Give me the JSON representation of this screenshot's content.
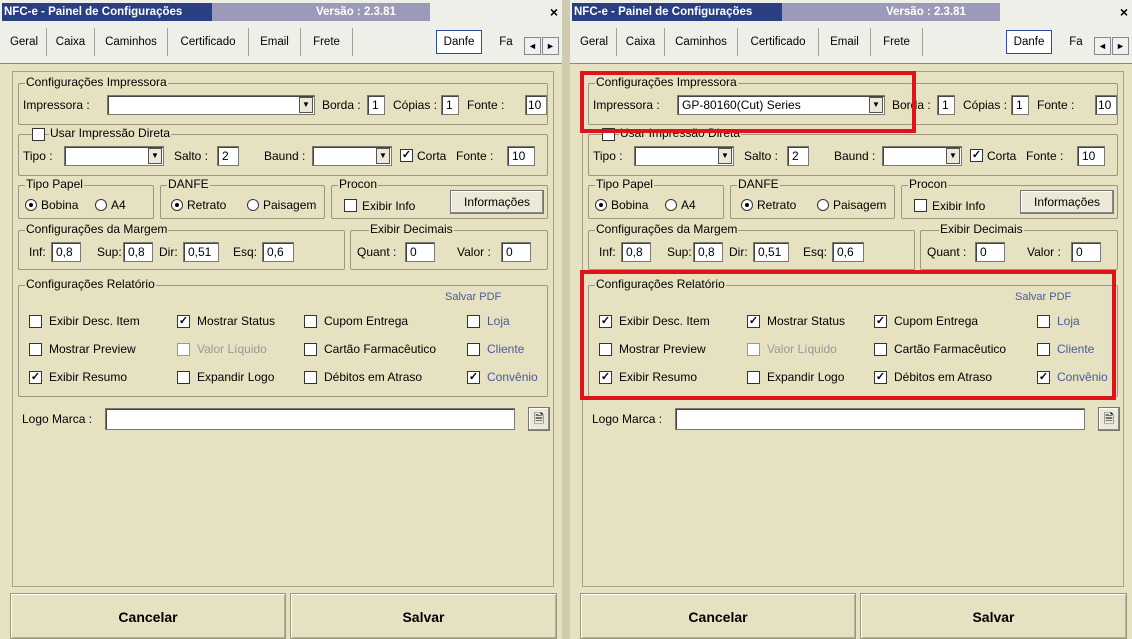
{
  "window": {
    "title": "NFC-e - Painel de Configurações",
    "version": "Versão : 2.3.81",
    "close": "×"
  },
  "tabs": [
    "Geral",
    "Caixa",
    "Caminhos",
    "Certificado",
    "Email",
    "Frete",
    "Danfe",
    "Fa"
  ],
  "active_tab": "Danfe",
  "scroll": {
    "left": "◄",
    "right": "►"
  },
  "impressora": {
    "legend": "Configurações Impressora",
    "label": "Impressora :",
    "left_value": "",
    "right_value": "GP-80160(Cut) Series",
    "borda_label": "Borda :",
    "borda_value": "1",
    "copias_label": "Cópias :",
    "copias_value": "1",
    "fonte_label": "Fonte :",
    "fonte_value": "10"
  },
  "direta": {
    "legend": "Usar Impressão Direta",
    "tipo_label": "Tipo :",
    "tipo_value": "",
    "salto_label": "Salto :",
    "salto_value": "2",
    "baund_label": "Baund :",
    "baund_value": "",
    "corta_label": "Corta",
    "corta_checked": true,
    "fonte_label": "Fonte :",
    "fonte_value": "10"
  },
  "tipo_papel": {
    "legend": "Tipo Papel",
    "bobina": "Bobina",
    "a4": "A4",
    "selected": "Bobina"
  },
  "danfe": {
    "legend": "DANFE",
    "retrato": "Retrato",
    "paisagem": "Paisagem",
    "selected": "Retrato"
  },
  "procon": {
    "legend": "Procon",
    "exibir_info": "Exibir Info",
    "informacoes_button": "Informações"
  },
  "margem": {
    "legend": "Configurações da Margem",
    "inf_label": "Inf:",
    "inf": "0,8",
    "sup_label": "Sup:",
    "sup": "0,8",
    "dir_label": "Dir:",
    "dir": "0,51",
    "esq_label": "Esq:",
    "esq": "0,6"
  },
  "decimais": {
    "legend": "Exibir Decimais",
    "quant_label": "Quant :",
    "quant": "0",
    "valor_label": "Valor :",
    "valor": "0"
  },
  "relatorio": {
    "legend": "Configurações Relatório",
    "salvar_pdf": "Salvar PDF",
    "items": {
      "exibir_desc_item": "Exibir Desc. Item",
      "mostrar_status": "Mostrar Status",
      "cupom_entrega": "Cupom Entrega",
      "loja": "Loja",
      "mostrar_preview": "Mostrar Preview",
      "valor_liquido": "Valor Líquido",
      "cartao_farmaceutico": "Cartão Farmacêutico",
      "cliente": "Cliente",
      "exibir_resumo": "Exibir Resumo",
      "expandir_logo": "Expandir Logo",
      "debitos_atraso": "Débitos em Atraso",
      "convenio": "Convênio"
    },
    "left_checked": {
      "exibir_desc_item": false,
      "mostrar_status": true,
      "cupom_entrega": false,
      "loja": false,
      "mostrar_preview": false,
      "valor_liquido": false,
      "cartao_farmaceutico": false,
      "cliente": false,
      "exibir_resumo": true,
      "expandir_logo": false,
      "debitos_atraso": false,
      "convenio": true
    },
    "right_checked": {
      "exibir_desc_item": true,
      "mostrar_status": true,
      "cupom_entrega": true,
      "loja": false,
      "mostrar_preview": false,
      "valor_liquido": false,
      "cartao_farmaceutico": false,
      "cliente": false,
      "exibir_resumo": true,
      "expandir_logo": false,
      "debitos_atraso": true,
      "convenio": true
    }
  },
  "logo": {
    "label": "Logo Marca :",
    "value": ""
  },
  "buttons": {
    "cancelar": "Cancelar",
    "salvar": "Salvar"
  },
  "highlight_color": "#e0131b"
}
